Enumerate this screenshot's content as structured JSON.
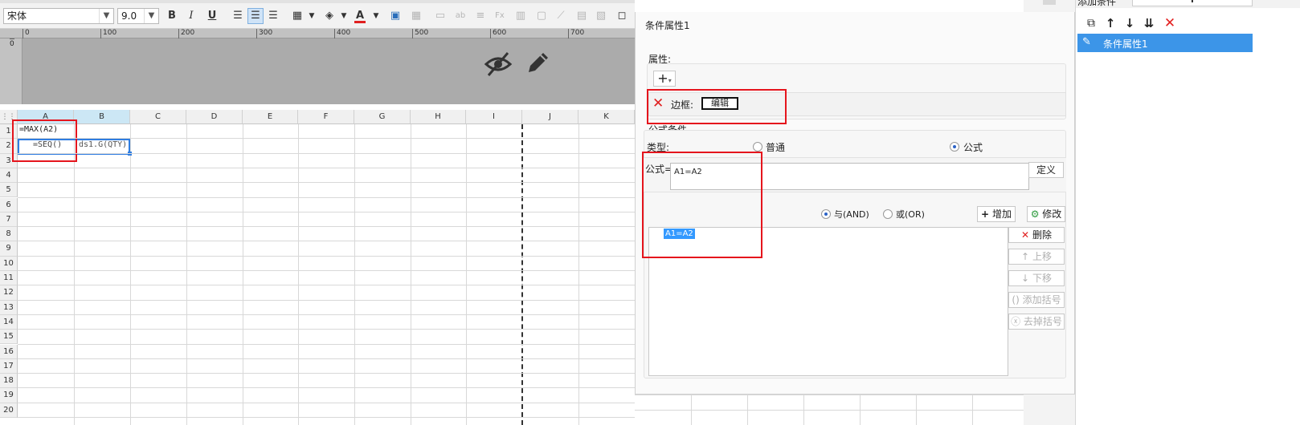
{
  "toolbar": {
    "font_name": "宋体",
    "font_size": "9.0",
    "bold": "B",
    "italic": "I",
    "underline": "U",
    "font_color_glyph": "A",
    "colors": {
      "font_color_bar": "#e02020",
      "selected_bg": "#cfe3f7"
    }
  },
  "ruler": {
    "ticks": [
      "0",
      "100",
      "200",
      "300",
      "400",
      "500",
      "600",
      "700"
    ],
    "vruler_tick": "0"
  },
  "grid": {
    "columns": [
      "A",
      "B",
      "C",
      "D",
      "E",
      "F",
      "G",
      "H",
      "I",
      "J",
      "K"
    ],
    "rows": [
      "1",
      "2",
      "3",
      "4",
      "5",
      "6",
      "7",
      "8",
      "9",
      "10",
      "11",
      "12",
      "13",
      "14",
      "15",
      "16",
      "17",
      "18",
      "19",
      "20"
    ],
    "cells": {
      "A1": "=MAX(A2)",
      "A2": "=SEQ()",
      "B2": "ds1.G(QTY)"
    }
  },
  "dialog": {
    "title": "条件属性1",
    "attr_label": "属性:",
    "add_glyph": "+",
    "border_label": "边框:",
    "border_edit_button": "编辑",
    "formula_group_label": "公式条件",
    "type_label": "类型:",
    "type_options": [
      {
        "label": "普通",
        "checked": false
      },
      {
        "label": "公式",
        "checked": true
      }
    ],
    "formula_label": "公式=",
    "formula_value": "A1=A2",
    "define_button": "定义",
    "logic_options": [
      {
        "label": "与(AND)",
        "checked": true
      },
      {
        "label": "或(OR)",
        "checked": false
      }
    ],
    "add_button": "增加",
    "modify_button": "修改",
    "condition_items": [
      "A1=A2"
    ],
    "side_buttons": [
      {
        "label": "删除",
        "icon": "delete-x-icon",
        "enabled": true
      },
      {
        "label": "上移",
        "icon": "arrow-up-icon",
        "enabled": false
      },
      {
        "label": "下移",
        "icon": "arrow-down-icon",
        "enabled": false
      },
      {
        "label": "添加括号",
        "icon": "bracket-icon",
        "enabled": false
      },
      {
        "label": "去掉括号",
        "icon": "remove-bracket-icon",
        "enabled": false
      }
    ]
  },
  "right_panel": {
    "header_label": "添加条件",
    "header_add_glyph": "+",
    "list_items": [
      "条件属性1"
    ],
    "colors": {
      "selected_row": "#3c95e8"
    }
  }
}
